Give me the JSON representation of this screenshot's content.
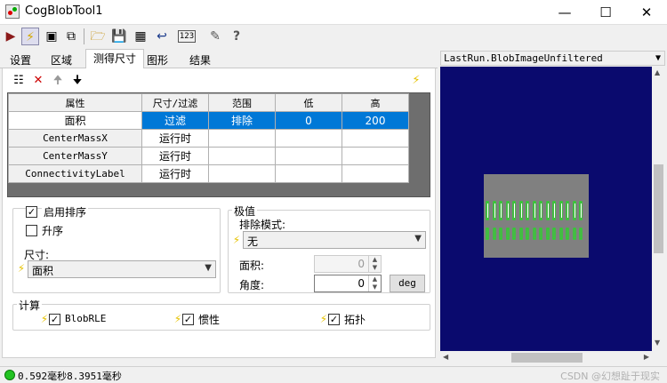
{
  "window": {
    "title": "CogBlobTool1"
  },
  "tabs": [
    {
      "label": "设置"
    },
    {
      "label": "区域"
    },
    {
      "label": "测得尺寸"
    },
    {
      "label": "图形"
    },
    {
      "label": "结果"
    }
  ],
  "active_tab": "测得尺寸",
  "grid": {
    "headers": [
      "属性",
      "尺寸/过滤",
      "范围",
      "低",
      "高"
    ],
    "rows": [
      {
        "name": "面积",
        "mode": "过滤",
        "range": "排除",
        "low": "0",
        "high": "200"
      },
      {
        "name": "CenterMassX",
        "mode": "运行时",
        "range": "",
        "low": "",
        "high": ""
      },
      {
        "name": "CenterMassY",
        "mode": "运行时",
        "range": "",
        "low": "",
        "high": ""
      },
      {
        "name": "ConnectivityLabel",
        "mode": "运行时",
        "range": "",
        "low": "",
        "high": ""
      }
    ]
  },
  "sorting": {
    "enable_label": "启用排序",
    "enable_checked": true,
    "ascending_label": "升序",
    "ascending_checked": false,
    "size_label": "尺寸:",
    "size_value": "面积"
  },
  "extrema": {
    "group_label": "极值",
    "exclude_mode_label": "排除模式:",
    "exclude_mode_value": "无",
    "area_label": "面积:",
    "area_value": "0",
    "angle_label": "角度:",
    "angle_value": "0",
    "deg_button": "deg"
  },
  "compute": {
    "group_label": "计算",
    "blobrle_label": "BlobRLE",
    "blobrle_checked": true,
    "inertia_label": "惯性",
    "inertia_checked": true,
    "topology_label": "拓扑",
    "topology_checked": true
  },
  "viewer": {
    "title": "LastRun.BlobImageUnfiltered"
  },
  "status": {
    "text": "0.592毫秒8.3951毫秒",
    "ok_color": "#22c322"
  },
  "watermark": "CSDN @幻想趾于现实",
  "colors": {
    "selection": "#0078d7",
    "viewer_bg": "#0a0a6e",
    "blob_green": "#22dd22"
  }
}
